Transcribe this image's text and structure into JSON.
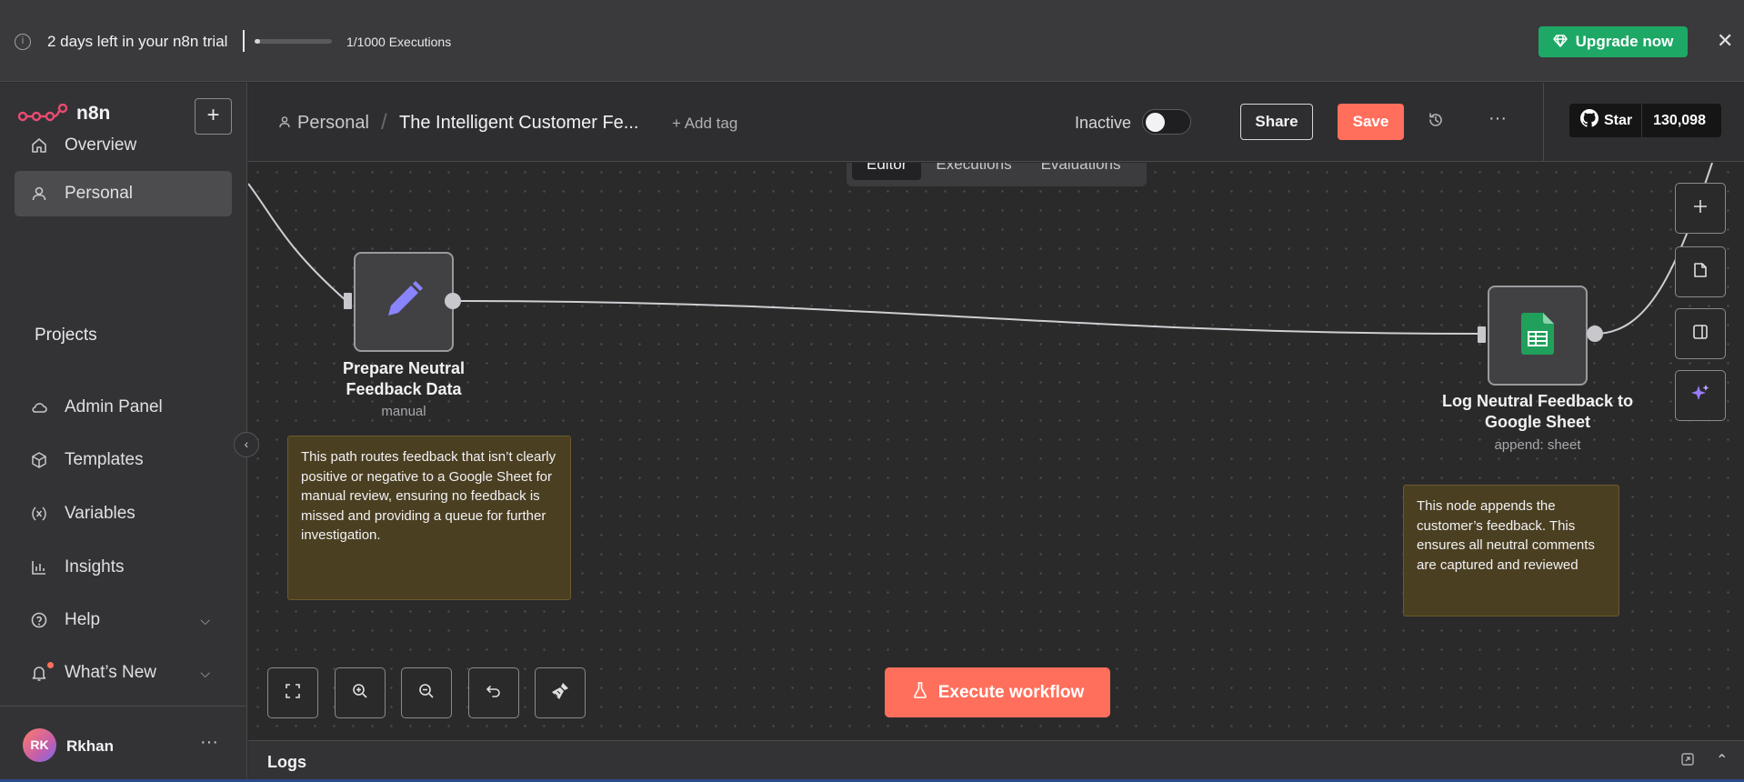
{
  "banner": {
    "info_icon": "info-circle-icon",
    "trial_text": "2 days left in your n8n trial",
    "executions_used": 1,
    "executions_total": 1000,
    "executions_text": "1/1000 Executions",
    "upgrade_label": "Upgrade now",
    "upgrade_icon": "gem-icon",
    "close_icon": "close-icon",
    "accent_color": "#1ea866"
  },
  "sidebar": {
    "logo_text": "n8n",
    "create_icon": "plus-icon",
    "nav": [
      {
        "label": "Overview",
        "icon": "home-icon",
        "active": false
      },
      {
        "label": "Personal",
        "icon": "user-icon",
        "active": true
      }
    ],
    "projects_title": "Projects",
    "items": [
      {
        "label": "Admin Panel",
        "icon": "cloud-icon"
      },
      {
        "label": "Templates",
        "icon": "box-icon"
      },
      {
        "label": "Variables",
        "icon": "variable-icon"
      },
      {
        "label": "Insights",
        "icon": "bar-chart-icon"
      },
      {
        "label": "Help",
        "icon": "question-circle-icon"
      },
      {
        "label": "What’s New",
        "icon": "bell-icon"
      }
    ],
    "user": {
      "initials": "RK",
      "name": "Rkhan"
    }
  },
  "header": {
    "breadcrumb_project": "Personal",
    "workflow_title": "The Intelligent Customer Fe...",
    "add_tag": "+ Add tag",
    "status_label": "Inactive",
    "share_label": "Share",
    "save_label": "Save",
    "github_star_label": "Star",
    "github_star_count": "130,098",
    "brand_color": "#ff6f5c"
  },
  "tabs": [
    "Editor",
    "Executions",
    "Evaluations"
  ],
  "active_tab": "Editor",
  "nodes": [
    {
      "name": "Prepare Neutral Feedback Data",
      "line1": "Prepare Neutral",
      "line2": "Feedback Data",
      "subtitle": "manual",
      "icon": "pencil-icon",
      "icon_color": "#8a85ff"
    },
    {
      "name": "Log Neutral Feedback to Google Sheet",
      "line1": "Log Neutral Feedback to",
      "line2": "Google Sheet",
      "subtitle": "append: sheet",
      "icon": "google-sheets-icon",
      "icon_color": "#20a05b"
    }
  ],
  "sticky_notes": [
    "This path routes feedback that isn’t clearly positive or negative to a Google Sheet for manual review, ensuring no feedback is missed and providing a queue for further investigation.",
    "This node appends the customer’s feedback. This ensures all neutral comments are captured and reviewed"
  ],
  "canvas_controls": [
    "fit-view-icon",
    "zoom-in-icon",
    "zoom-out-icon",
    "undo-icon",
    "tidy-up-icon"
  ],
  "right_panel_controls": [
    "plus-icon",
    "sticky-note-icon",
    "panel-icon",
    "ai-sparkle-icon"
  ],
  "execute_label": "Execute workflow",
  "logs_title": "Logs"
}
